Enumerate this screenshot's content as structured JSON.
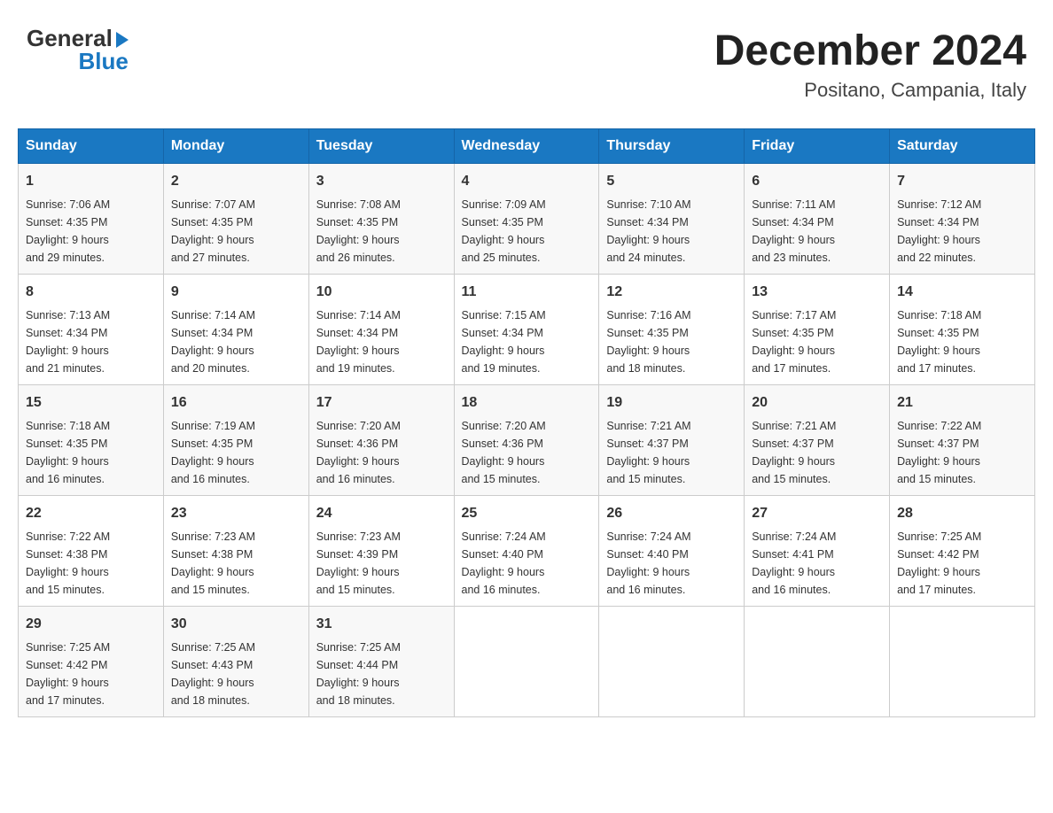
{
  "header": {
    "logo_top": "General",
    "logo_bottom": "Blue",
    "title": "December 2024",
    "subtitle": "Positano, Campania, Italy"
  },
  "calendar": {
    "days_of_week": [
      "Sunday",
      "Monday",
      "Tuesday",
      "Wednesday",
      "Thursday",
      "Friday",
      "Saturday"
    ],
    "weeks": [
      [
        {
          "day": "1",
          "sunrise": "7:06 AM",
          "sunset": "4:35 PM",
          "daylight": "9 hours and 29 minutes."
        },
        {
          "day": "2",
          "sunrise": "7:07 AM",
          "sunset": "4:35 PM",
          "daylight": "9 hours and 27 minutes."
        },
        {
          "day": "3",
          "sunrise": "7:08 AM",
          "sunset": "4:35 PM",
          "daylight": "9 hours and 26 minutes."
        },
        {
          "day": "4",
          "sunrise": "7:09 AM",
          "sunset": "4:35 PM",
          "daylight": "9 hours and 25 minutes."
        },
        {
          "day": "5",
          "sunrise": "7:10 AM",
          "sunset": "4:34 PM",
          "daylight": "9 hours and 24 minutes."
        },
        {
          "day": "6",
          "sunrise": "7:11 AM",
          "sunset": "4:34 PM",
          "daylight": "9 hours and 23 minutes."
        },
        {
          "day": "7",
          "sunrise": "7:12 AM",
          "sunset": "4:34 PM",
          "daylight": "9 hours and 22 minutes."
        }
      ],
      [
        {
          "day": "8",
          "sunrise": "7:13 AM",
          "sunset": "4:34 PM",
          "daylight": "9 hours and 21 minutes."
        },
        {
          "day": "9",
          "sunrise": "7:14 AM",
          "sunset": "4:34 PM",
          "daylight": "9 hours and 20 minutes."
        },
        {
          "day": "10",
          "sunrise": "7:14 AM",
          "sunset": "4:34 PM",
          "daylight": "9 hours and 19 minutes."
        },
        {
          "day": "11",
          "sunrise": "7:15 AM",
          "sunset": "4:34 PM",
          "daylight": "9 hours and 19 minutes."
        },
        {
          "day": "12",
          "sunrise": "7:16 AM",
          "sunset": "4:35 PM",
          "daylight": "9 hours and 18 minutes."
        },
        {
          "day": "13",
          "sunrise": "7:17 AM",
          "sunset": "4:35 PM",
          "daylight": "9 hours and 17 minutes."
        },
        {
          "day": "14",
          "sunrise": "7:18 AM",
          "sunset": "4:35 PM",
          "daylight": "9 hours and 17 minutes."
        }
      ],
      [
        {
          "day": "15",
          "sunrise": "7:18 AM",
          "sunset": "4:35 PM",
          "daylight": "9 hours and 16 minutes."
        },
        {
          "day": "16",
          "sunrise": "7:19 AM",
          "sunset": "4:35 PM",
          "daylight": "9 hours and 16 minutes."
        },
        {
          "day": "17",
          "sunrise": "7:20 AM",
          "sunset": "4:36 PM",
          "daylight": "9 hours and 16 minutes."
        },
        {
          "day": "18",
          "sunrise": "7:20 AM",
          "sunset": "4:36 PM",
          "daylight": "9 hours and 15 minutes."
        },
        {
          "day": "19",
          "sunrise": "7:21 AM",
          "sunset": "4:37 PM",
          "daylight": "9 hours and 15 minutes."
        },
        {
          "day": "20",
          "sunrise": "7:21 AM",
          "sunset": "4:37 PM",
          "daylight": "9 hours and 15 minutes."
        },
        {
          "day": "21",
          "sunrise": "7:22 AM",
          "sunset": "4:37 PM",
          "daylight": "9 hours and 15 minutes."
        }
      ],
      [
        {
          "day": "22",
          "sunrise": "7:22 AM",
          "sunset": "4:38 PM",
          "daylight": "9 hours and 15 minutes."
        },
        {
          "day": "23",
          "sunrise": "7:23 AM",
          "sunset": "4:38 PM",
          "daylight": "9 hours and 15 minutes."
        },
        {
          "day": "24",
          "sunrise": "7:23 AM",
          "sunset": "4:39 PM",
          "daylight": "9 hours and 15 minutes."
        },
        {
          "day": "25",
          "sunrise": "7:24 AM",
          "sunset": "4:40 PM",
          "daylight": "9 hours and 16 minutes."
        },
        {
          "day": "26",
          "sunrise": "7:24 AM",
          "sunset": "4:40 PM",
          "daylight": "9 hours and 16 minutes."
        },
        {
          "day": "27",
          "sunrise": "7:24 AM",
          "sunset": "4:41 PM",
          "daylight": "9 hours and 16 minutes."
        },
        {
          "day": "28",
          "sunrise": "7:25 AM",
          "sunset": "4:42 PM",
          "daylight": "9 hours and 17 minutes."
        }
      ],
      [
        {
          "day": "29",
          "sunrise": "7:25 AM",
          "sunset": "4:42 PM",
          "daylight": "9 hours and 17 minutes."
        },
        {
          "day": "30",
          "sunrise": "7:25 AM",
          "sunset": "4:43 PM",
          "daylight": "9 hours and 18 minutes."
        },
        {
          "day": "31",
          "sunrise": "7:25 AM",
          "sunset": "4:44 PM",
          "daylight": "9 hours and 18 minutes."
        },
        null,
        null,
        null,
        null
      ]
    ],
    "labels": {
      "sunrise": "Sunrise:",
      "sunset": "Sunset:",
      "daylight": "Daylight:"
    }
  }
}
